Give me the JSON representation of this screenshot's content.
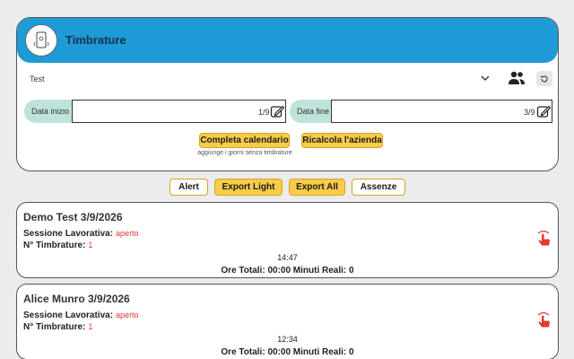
{
  "header": {
    "title": "Timbrature",
    "logo_icon": "phone-timestamp-icon",
    "accent": "#1e9ad6"
  },
  "filters": {
    "selected_user": "Test",
    "dropdown_icon": "chevron-down-icon",
    "group_icon": "people-icon",
    "reset_icon": "refresh-icon",
    "start_label": "Data inizio",
    "start_value": "1/9",
    "end_label": "Data fine",
    "end_value": "3/9"
  },
  "actions": {
    "complete_calendar": "Completa calendario",
    "complete_hint": "aggiunge i giorni senza timbrature",
    "recalculate": "Ricalcola l'azienda",
    "alert": "Alert",
    "export_light": "Export Light",
    "export_all": "Export All",
    "absences": "Assenze",
    "button_color": "#f9cc4b"
  },
  "records": [
    {
      "title": "Demo Test 3/9/2026",
      "session_label": "Sessione Lavorativa:",
      "session_value": "aperto",
      "count_label": "N° Timbrature:",
      "count_value": "1",
      "time": "14:47",
      "totals": "Ore Totali: 00:00 Minuti Reali: 0",
      "icon": "tap-hand-icon"
    },
    {
      "title": "Alice Munro 3/9/2026",
      "session_label": "Sessione Lavorativa:",
      "session_value": "aperto",
      "count_label": "N° Timbrature:",
      "count_value": "1",
      "time": "12:34",
      "totals": "Ore Totali: 00:00 Minuti Reali: 0",
      "icon": "tap-hand-icon"
    }
  ]
}
